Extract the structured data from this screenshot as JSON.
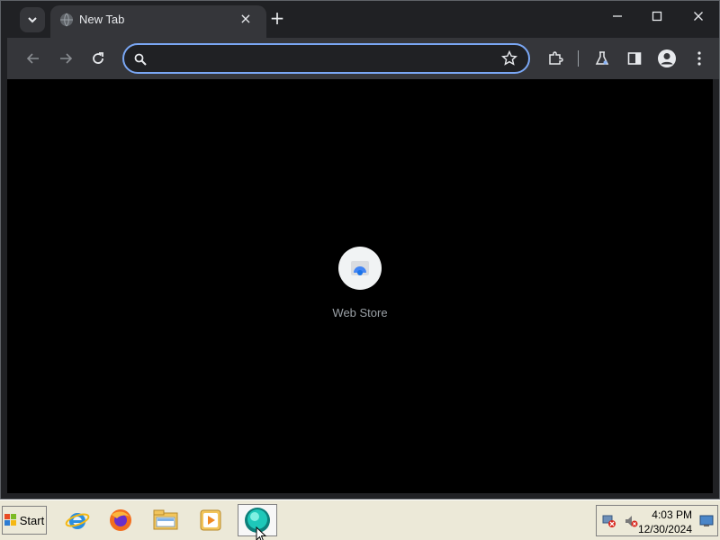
{
  "browser": {
    "tab": {
      "title": "New Tab",
      "favicon": "globe-icon"
    },
    "omnibox": {
      "value": "",
      "placeholder": ""
    },
    "shortcuts": [
      {
        "label": "Web Store",
        "icon": "web-store-icon"
      }
    ]
  },
  "taskbar": {
    "start_label": "Start",
    "apps": [
      {
        "name": "internet-explorer",
        "icon": "ie-icon"
      },
      {
        "name": "firefox",
        "icon": "firefox-icon"
      },
      {
        "name": "file-explorer",
        "icon": "folder-icon"
      },
      {
        "name": "media-player",
        "icon": "media-player-icon"
      },
      {
        "name": "chrome-app",
        "icon": "teal-app-icon",
        "active": true
      }
    ],
    "tray": {
      "time": "4:03 PM",
      "date": "12/30/2024"
    }
  },
  "colors": {
    "browser_chrome": "#202124",
    "toolbar": "#35363a",
    "omnibox_focus": "#7aa7f4",
    "content_bg": "#000000",
    "taskbar_bg": "#ece9d8"
  }
}
